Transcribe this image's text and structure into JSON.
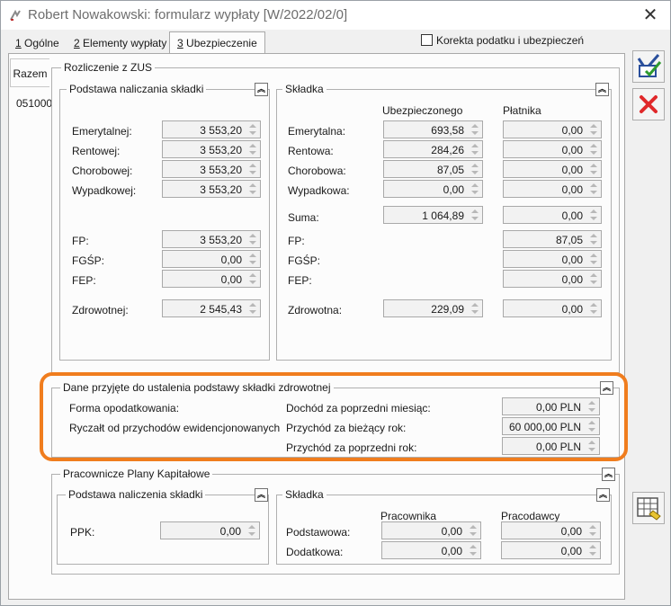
{
  "window": {
    "title": "Robert Nowakowski: formularz wypłaty [W/2022/02/0]"
  },
  "tabs": [
    {
      "key": "1",
      "label": " Ogólne"
    },
    {
      "key": "2",
      "label": " Elementy wypłaty"
    },
    {
      "key": "3",
      "label": " Ubezpieczenie"
    }
  ],
  "korekta": {
    "label": "Korekta podatku i ubezpieczeń"
  },
  "side": {
    "tab": "Razem",
    "code": "051000"
  },
  "zus": {
    "title": "Rozliczenie z ZUS",
    "podstawa": {
      "title": "Podstawa naliczania składki",
      "rows": [
        {
          "label": "Emerytalnej:",
          "value": "3 553,20"
        },
        {
          "label": "Rentowej:",
          "value": "3 553,20"
        },
        {
          "label": "Chorobowej:",
          "value": "3 553,20"
        },
        {
          "label": "Wypadkowej:",
          "value": "3 553,20"
        },
        {
          "label": "FP:",
          "value": "3 553,20"
        },
        {
          "label": "FGŚP:",
          "value": "0,00"
        },
        {
          "label": "FEP:",
          "value": "0,00"
        },
        {
          "label": "Zdrowotnej:",
          "value": "2 545,43"
        }
      ]
    },
    "skladka": {
      "title": "Składka",
      "col_ubezp": "Ubezpieczonego",
      "col_platnik": "Płatnika",
      "rows": [
        {
          "label": "Emerytalna:",
          "ubezp": "693,58",
          "platnik": "0,00"
        },
        {
          "label": "Rentowa:",
          "ubezp": "284,26",
          "platnik": "0,00"
        },
        {
          "label": "Chorobowa:",
          "ubezp": "87,05",
          "platnik": "0,00"
        },
        {
          "label": "Wypadkowa:",
          "ubezp": "0,00",
          "platnik": "0,00"
        },
        {
          "label": "Suma:",
          "ubezp": "1 064,89",
          "platnik": "0,00"
        },
        {
          "label": "FP:",
          "platnik": "87,05"
        },
        {
          "label": "FGŚP:",
          "platnik": "0,00"
        },
        {
          "label": "FEP:",
          "platnik": "0,00"
        },
        {
          "label": "Zdrowotna:",
          "ubezp": "229,09",
          "platnik": "0,00"
        }
      ]
    }
  },
  "zdrowotna": {
    "title": "Dane przyjęte do ustalenia podstawy składki zdrowotnej",
    "forma_label": "Forma opodatkowania:",
    "forma_value": "Ryczałt od przychodów ewidencjonowanych",
    "rows": [
      {
        "label": "Dochód za poprzedni miesiąc:",
        "value": "0,00 PLN"
      },
      {
        "label": "Przychód za bieżący rok:",
        "value": "60 000,00 PLN"
      },
      {
        "label": "Przychód za poprzedni rok:",
        "value": "0,00 PLN"
      }
    ]
  },
  "ppk": {
    "title": "Pracownicze Plany Kapitałowe",
    "podstawa": {
      "title": "Podstawa naliczenia składki",
      "label": "PPK:",
      "value": "0,00"
    },
    "skladka": {
      "title": "Składka",
      "col_pracownika": "Pracownika",
      "col_pracodawcy": "Pracodawcy",
      "rows": [
        {
          "label": "Podstawowa:",
          "pracownika": "0,00",
          "pracodawcy": "0,00"
        },
        {
          "label": "Dodatkowa:",
          "pracownika": "0,00",
          "pracodawcy": "0,00"
        }
      ]
    }
  },
  "colors": {
    "highlight": "#f07d1e",
    "save_icon": "#2a4f9c",
    "check_icon": "#2e9a2e",
    "cancel_icon": "#e0282a"
  }
}
